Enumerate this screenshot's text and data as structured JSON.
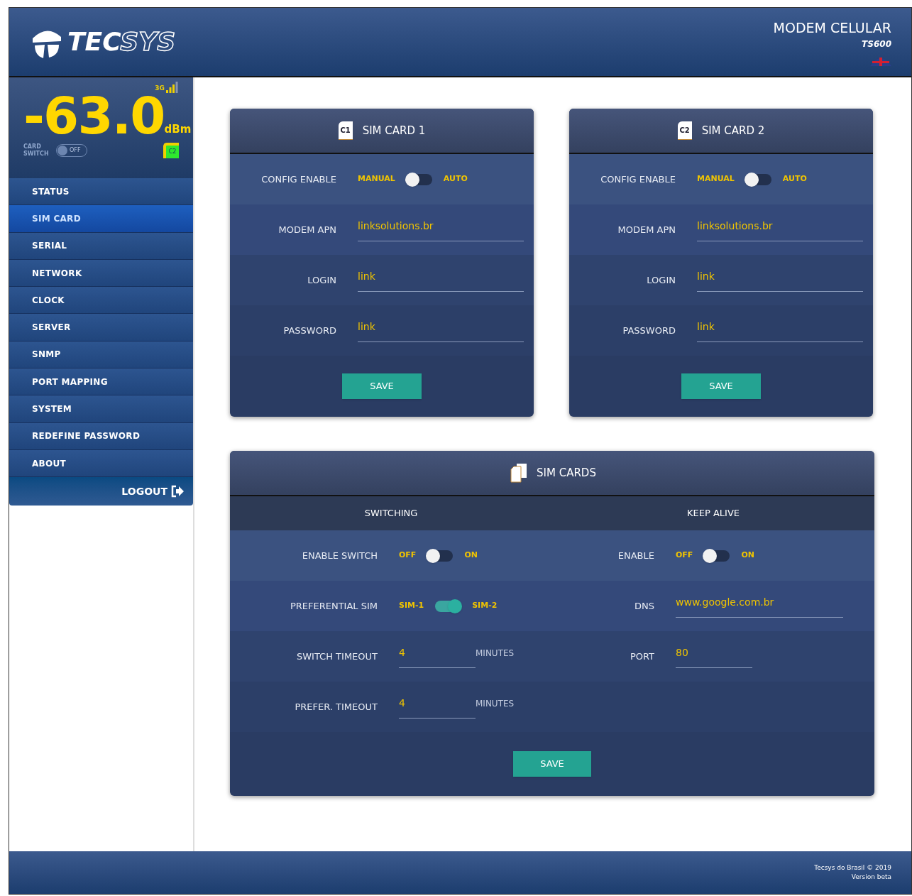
{
  "header": {
    "logo_bold": "TEC",
    "logo_outline": "SYS",
    "title": "MODEM CELULAR",
    "model": "TS600"
  },
  "signal": {
    "network": "3G",
    "reading": "-63.0",
    "unit": "dBm",
    "card_switch_label": "CARD SWITCH",
    "card_switch_state": "OFF",
    "card_switch_on": false,
    "active_sim": "C2"
  },
  "nav": [
    {
      "label": "STATUS",
      "selected": false
    },
    {
      "label": "SIM CARD",
      "selected": true
    },
    {
      "label": "SERIAL",
      "selected": false
    },
    {
      "label": "NETWORK",
      "selected": false
    },
    {
      "label": "CLOCK",
      "selected": false
    },
    {
      "label": "SERVER",
      "selected": false
    },
    {
      "label": "SNMP",
      "selected": false
    },
    {
      "label": "PORT MAPPING",
      "selected": false
    },
    {
      "label": "SYSTEM",
      "selected": false
    },
    {
      "label": "REDEFINE PASSWORD",
      "selected": false
    },
    {
      "label": "ABOUT",
      "selected": false
    }
  ],
  "logout": "LOGOUT",
  "sim_panels": [
    {
      "badge": "C1",
      "title": "SIM CARD 1",
      "rows": [
        {
          "kind": "toggle",
          "label": "CONFIG ENABLE",
          "off_label": "MANUAL",
          "on_label": "AUTO",
          "on": false
        },
        {
          "kind": "field",
          "label": "MODEM APN",
          "value": "linksolutions.br"
        },
        {
          "kind": "field",
          "label": "LOGIN",
          "value": "link"
        },
        {
          "kind": "field",
          "label": "PASSWORD",
          "value": "link"
        }
      ],
      "save": "SAVE"
    },
    {
      "badge": "C2",
      "title": "SIM CARD 2",
      "rows": [
        {
          "kind": "toggle",
          "label": "CONFIG ENABLE",
          "off_label": "MANUAL",
          "on_label": "AUTO",
          "on": false
        },
        {
          "kind": "field",
          "label": "MODEM APN",
          "value": "linksolutions.br"
        },
        {
          "kind": "field",
          "label": "LOGIN",
          "value": "link"
        },
        {
          "kind": "field",
          "label": "PASSWORD",
          "value": "link"
        }
      ],
      "save": "SAVE"
    }
  ],
  "sim_cards": {
    "title": "SIM CARDS",
    "columns": [
      {
        "heading": "SWITCHING",
        "rows": [
          {
            "kind": "toggle",
            "label": "ENABLE SWITCH",
            "off_label": "OFF",
            "on_label": "ON",
            "on": false
          },
          {
            "kind": "toggle",
            "label": "PREFERENTIAL SIM",
            "off_label": "SIM-1",
            "on_label": "SIM-2",
            "on": true
          },
          {
            "kind": "field",
            "label": "SWITCH TIMEOUT",
            "value": "4",
            "unit": "MINUTES"
          },
          {
            "kind": "field",
            "label": "PREFER. TIMEOUT",
            "value": "4",
            "unit": "MINUTES"
          }
        ]
      },
      {
        "heading": "KEEP ALIVE",
        "rows": [
          {
            "kind": "toggle",
            "label": "ENABLE",
            "off_label": "OFF",
            "on_label": "ON",
            "on": false
          },
          {
            "kind": "field",
            "label": "DNS",
            "value": "www.google.com.br"
          },
          {
            "kind": "field",
            "label": "PORT",
            "value": "80"
          }
        ]
      }
    ],
    "save": "SAVE"
  },
  "footer": {
    "copyright": "Tecsys do Brasil © 2019",
    "version": "Version beta"
  }
}
